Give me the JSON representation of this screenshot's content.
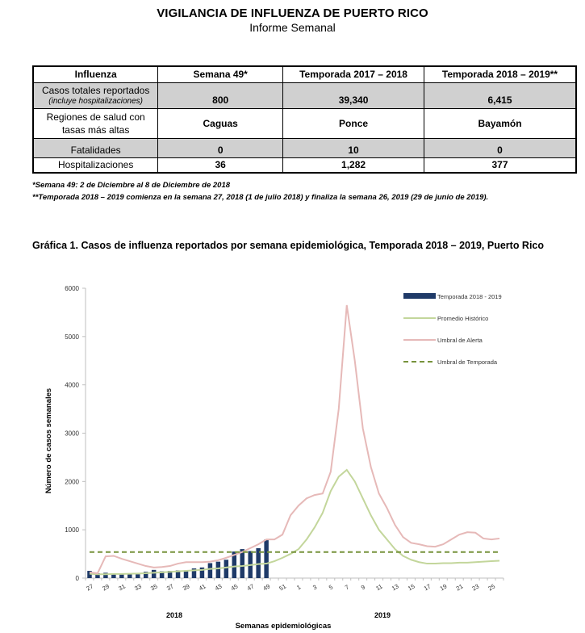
{
  "header": {
    "title": "VIGILANCIA DE INFLUENZA DE PUERTO RICO",
    "subtitle": "Informe Semanal"
  },
  "table": {
    "headers": [
      "Influenza",
      "Semana 49*",
      "Temporada 2017 – 2018",
      "Temporada 2018 – 2019**"
    ],
    "rows": [
      {
        "label": "Casos totales reportados",
        "sublabel": "(incluye hospitalizaciones)",
        "values": [
          "800",
          "39,340",
          "6,415"
        ]
      },
      {
        "label": "Regiones de salud con tasas más altas",
        "sublabel": "",
        "values": [
          "Caguas",
          "Ponce",
          "Bayamón"
        ]
      },
      {
        "label": "Fatalidades",
        "sublabel": "",
        "values": [
          "0",
          "10",
          "0"
        ]
      },
      {
        "label": "Hospitalizaciones",
        "sublabel": "",
        "values": [
          "36",
          "1,282",
          "377"
        ]
      }
    ]
  },
  "notes": {
    "note1": "*Semana 49: 2 de Diciembre al 8 de Diciembre de 2018",
    "note2": "**Temporada 2018 – 2019 comienza en la semana 27, 2018 (1 de julio 2018) y finaliza la semana 26, 2019 (29 de junio de 2019)."
  },
  "chart_title": "Gráfica 1. Casos de influenza reportados por semana epidemiológica, Temporada 2018 – 2019, Puerto Rico",
  "chart_data": {
    "type": "bar",
    "ylabel": "Número de casos semanales",
    "xlabel": "Semanas epidemiológicas",
    "ylim": [
      0,
      6000
    ],
    "yticks": [
      "0",
      "1000",
      "2000",
      "3000",
      "4000",
      "5000",
      "6000"
    ],
    "year_labels": [
      "2018",
      "2019"
    ],
    "x": [
      27,
      28,
      29,
      30,
      31,
      32,
      33,
      34,
      35,
      36,
      37,
      38,
      39,
      40,
      41,
      42,
      43,
      44,
      45,
      46,
      47,
      48,
      49,
      50,
      51,
      52,
      1,
      2,
      3,
      4,
      5,
      6,
      7,
      8,
      9,
      10,
      11,
      12,
      13,
      14,
      15,
      16,
      17,
      18,
      19,
      20,
      21,
      22,
      23,
      24,
      25,
      26
    ],
    "xtick_labels": [
      "27",
      "29",
      "31",
      "33",
      "35",
      "37",
      "39",
      "41",
      "43",
      "45",
      "47",
      "49",
      "51",
      "1",
      "3",
      "5",
      "7",
      "9",
      "11",
      "13",
      "15",
      "17",
      "19",
      "21",
      "23",
      "25"
    ],
    "legend_position": "top-right",
    "series": [
      {
        "name": "Temporada 2018 - 2019",
        "kind": "bar",
        "color": "#1f3a68",
        "values": [
          150,
          100,
          110,
          100,
          90,
          80,
          80,
          130,
          170,
          140,
          150,
          160,
          160,
          200,
          220,
          310,
          340,
          380,
          550,
          600,
          560,
          620,
          800
        ]
      },
      {
        "name": "Promedio Histórico",
        "kind": "line",
        "color": "#c3d69b",
        "values": [
          90,
          80,
          80,
          85,
          85,
          90,
          95,
          100,
          110,
          120,
          130,
          140,
          150,
          160,
          170,
          190,
          200,
          220,
          240,
          250,
          270,
          290,
          300,
          350,
          420,
          500,
          600,
          800,
          1050,
          1350,
          1800,
          2100,
          2240,
          2000,
          1650,
          1300,
          1000,
          800,
          600,
          460,
          380,
          330,
          300,
          300,
          310,
          310,
          320,
          320,
          330,
          340,
          350,
          360
        ]
      },
      {
        "name": "Umbral de Alerta",
        "kind": "line",
        "color": "#e6b9b8",
        "values": [
          120,
          100,
          450,
          460,
          400,
          350,
          300,
          250,
          220,
          230,
          250,
          300,
          330,
          330,
          330,
          340,
          370,
          420,
          480,
          540,
          620,
          700,
          800,
          800,
          900,
          1300,
          1500,
          1650,
          1720,
          1750,
          2200,
          3500,
          5650,
          4500,
          3100,
          2300,
          1750,
          1450,
          1100,
          850,
          730,
          700,
          660,
          650,
          700,
          800,
          900,
          950,
          940,
          820,
          800,
          820
        ]
      },
      {
        "name": "Umbral de Temporada",
        "kind": "dashed",
        "color": "#77933c",
        "value": 540
      }
    ]
  },
  "colors": {
    "table_shade": "#d0d0d0",
    "bar": "#1f3a68",
    "avg_line": "#c3d69b",
    "alert_line": "#e6b9b8",
    "season_line": "#77933c"
  }
}
